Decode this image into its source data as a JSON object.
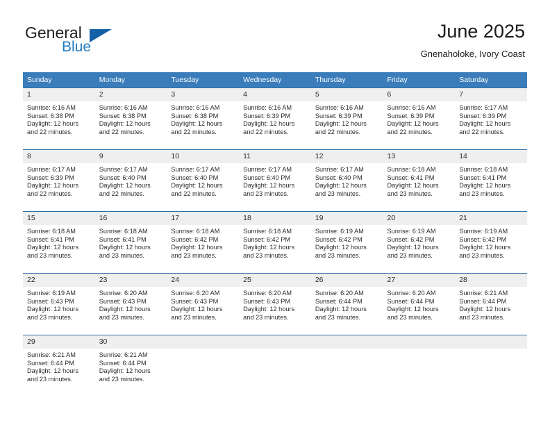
{
  "brand": {
    "name_part1": "General",
    "name_part2": "Blue",
    "flag_icon": "triangle-flag-icon"
  },
  "header": {
    "title": "June 2025",
    "subtitle": "Gnenaholoke, Ivory Coast"
  },
  "colors": {
    "header_blue": "#3b7dba",
    "row_border_blue": "#2f6fa8",
    "daynum_band": "#efefef",
    "brand_blue": "#1f7bc1",
    "flag_blue": "#1461a8",
    "text": "#2b2b2b"
  },
  "calendar": {
    "weekday_headers": [
      "Sunday",
      "Monday",
      "Tuesday",
      "Wednesday",
      "Thursday",
      "Friday",
      "Saturday"
    ],
    "weeks": [
      [
        {
          "day": "1",
          "sunrise": "Sunrise: 6:16 AM",
          "sunset": "Sunset: 6:38 PM",
          "daylight": "Daylight: 12 hours and 22 minutes."
        },
        {
          "day": "2",
          "sunrise": "Sunrise: 6:16 AM",
          "sunset": "Sunset: 6:38 PM",
          "daylight": "Daylight: 12 hours and 22 minutes."
        },
        {
          "day": "3",
          "sunrise": "Sunrise: 6:16 AM",
          "sunset": "Sunset: 6:38 PM",
          "daylight": "Daylight: 12 hours and 22 minutes."
        },
        {
          "day": "4",
          "sunrise": "Sunrise: 6:16 AM",
          "sunset": "Sunset: 6:39 PM",
          "daylight": "Daylight: 12 hours and 22 minutes."
        },
        {
          "day": "5",
          "sunrise": "Sunrise: 6:16 AM",
          "sunset": "Sunset: 6:39 PM",
          "daylight": "Daylight: 12 hours and 22 minutes."
        },
        {
          "day": "6",
          "sunrise": "Sunrise: 6:16 AM",
          "sunset": "Sunset: 6:39 PM",
          "daylight": "Daylight: 12 hours and 22 minutes."
        },
        {
          "day": "7",
          "sunrise": "Sunrise: 6:17 AM",
          "sunset": "Sunset: 6:39 PM",
          "daylight": "Daylight: 12 hours and 22 minutes."
        }
      ],
      [
        {
          "day": "8",
          "sunrise": "Sunrise: 6:17 AM",
          "sunset": "Sunset: 6:39 PM",
          "daylight": "Daylight: 12 hours and 22 minutes."
        },
        {
          "day": "9",
          "sunrise": "Sunrise: 6:17 AM",
          "sunset": "Sunset: 6:40 PM",
          "daylight": "Daylight: 12 hours and 22 minutes."
        },
        {
          "day": "10",
          "sunrise": "Sunrise: 6:17 AM",
          "sunset": "Sunset: 6:40 PM",
          "daylight": "Daylight: 12 hours and 22 minutes."
        },
        {
          "day": "11",
          "sunrise": "Sunrise: 6:17 AM",
          "sunset": "Sunset: 6:40 PM",
          "daylight": "Daylight: 12 hours and 23 minutes."
        },
        {
          "day": "12",
          "sunrise": "Sunrise: 6:17 AM",
          "sunset": "Sunset: 6:40 PM",
          "daylight": "Daylight: 12 hours and 23 minutes."
        },
        {
          "day": "13",
          "sunrise": "Sunrise: 6:18 AM",
          "sunset": "Sunset: 6:41 PM",
          "daylight": "Daylight: 12 hours and 23 minutes."
        },
        {
          "day": "14",
          "sunrise": "Sunrise: 6:18 AM",
          "sunset": "Sunset: 6:41 PM",
          "daylight": "Daylight: 12 hours and 23 minutes."
        }
      ],
      [
        {
          "day": "15",
          "sunrise": "Sunrise: 6:18 AM",
          "sunset": "Sunset: 6:41 PM",
          "daylight": "Daylight: 12 hours and 23 minutes."
        },
        {
          "day": "16",
          "sunrise": "Sunrise: 6:18 AM",
          "sunset": "Sunset: 6:41 PM",
          "daylight": "Daylight: 12 hours and 23 minutes."
        },
        {
          "day": "17",
          "sunrise": "Sunrise: 6:18 AM",
          "sunset": "Sunset: 6:42 PM",
          "daylight": "Daylight: 12 hours and 23 minutes."
        },
        {
          "day": "18",
          "sunrise": "Sunrise: 6:18 AM",
          "sunset": "Sunset: 6:42 PM",
          "daylight": "Daylight: 12 hours and 23 minutes."
        },
        {
          "day": "19",
          "sunrise": "Sunrise: 6:19 AM",
          "sunset": "Sunset: 6:42 PM",
          "daylight": "Daylight: 12 hours and 23 minutes."
        },
        {
          "day": "20",
          "sunrise": "Sunrise: 6:19 AM",
          "sunset": "Sunset: 6:42 PM",
          "daylight": "Daylight: 12 hours and 23 minutes."
        },
        {
          "day": "21",
          "sunrise": "Sunrise: 6:19 AM",
          "sunset": "Sunset: 6:42 PM",
          "daylight": "Daylight: 12 hours and 23 minutes."
        }
      ],
      [
        {
          "day": "22",
          "sunrise": "Sunrise: 6:19 AM",
          "sunset": "Sunset: 6:43 PM",
          "daylight": "Daylight: 12 hours and 23 minutes."
        },
        {
          "day": "23",
          "sunrise": "Sunrise: 6:20 AM",
          "sunset": "Sunset: 6:43 PM",
          "daylight": "Daylight: 12 hours and 23 minutes."
        },
        {
          "day": "24",
          "sunrise": "Sunrise: 6:20 AM",
          "sunset": "Sunset: 6:43 PM",
          "daylight": "Daylight: 12 hours and 23 minutes."
        },
        {
          "day": "25",
          "sunrise": "Sunrise: 6:20 AM",
          "sunset": "Sunset: 6:43 PM",
          "daylight": "Daylight: 12 hours and 23 minutes."
        },
        {
          "day": "26",
          "sunrise": "Sunrise: 6:20 AM",
          "sunset": "Sunset: 6:44 PM",
          "daylight": "Daylight: 12 hours and 23 minutes."
        },
        {
          "day": "27",
          "sunrise": "Sunrise: 6:20 AM",
          "sunset": "Sunset: 6:44 PM",
          "daylight": "Daylight: 12 hours and 23 minutes."
        },
        {
          "day": "28",
          "sunrise": "Sunrise: 6:21 AM",
          "sunset": "Sunset: 6:44 PM",
          "daylight": "Daylight: 12 hours and 23 minutes."
        }
      ],
      [
        {
          "day": "29",
          "sunrise": "Sunrise: 6:21 AM",
          "sunset": "Sunset: 6:44 PM",
          "daylight": "Daylight: 12 hours and 23 minutes."
        },
        {
          "day": "30",
          "sunrise": "Sunrise: 6:21 AM",
          "sunset": "Sunset: 6:44 PM",
          "daylight": "Daylight: 12 hours and 23 minutes."
        },
        {
          "day": "",
          "sunrise": "",
          "sunset": "",
          "daylight": ""
        },
        {
          "day": "",
          "sunrise": "",
          "sunset": "",
          "daylight": ""
        },
        {
          "day": "",
          "sunrise": "",
          "sunset": "",
          "daylight": ""
        },
        {
          "day": "",
          "sunrise": "",
          "sunset": "",
          "daylight": ""
        },
        {
          "day": "",
          "sunrise": "",
          "sunset": "",
          "daylight": ""
        }
      ]
    ]
  }
}
